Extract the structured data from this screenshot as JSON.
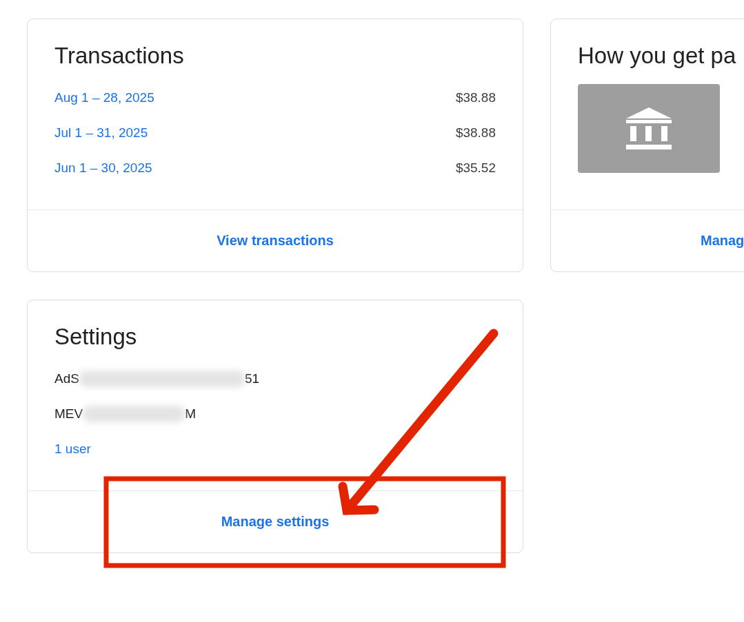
{
  "transactions": {
    "title": "Transactions",
    "rows": [
      {
        "period": "Aug 1 – 28, 2025",
        "amount": "$38.88"
      },
      {
        "period": "Jul 1 – 31, 2025",
        "amount": "$38.88"
      },
      {
        "period": "Jun 1 – 30, 2025",
        "amount": "$35.52"
      }
    ],
    "action": "View transactions"
  },
  "payment": {
    "title": "How you get pa",
    "action": "Manag"
  },
  "settings": {
    "title": "Settings",
    "lines": [
      {
        "start": "AdS",
        "end": "51"
      },
      {
        "start": "MEV",
        "end": "M"
      }
    ],
    "users": "1 user",
    "action": "Manage settings"
  },
  "annotation": {
    "kind": "arrow-box",
    "color": "#e32400"
  }
}
